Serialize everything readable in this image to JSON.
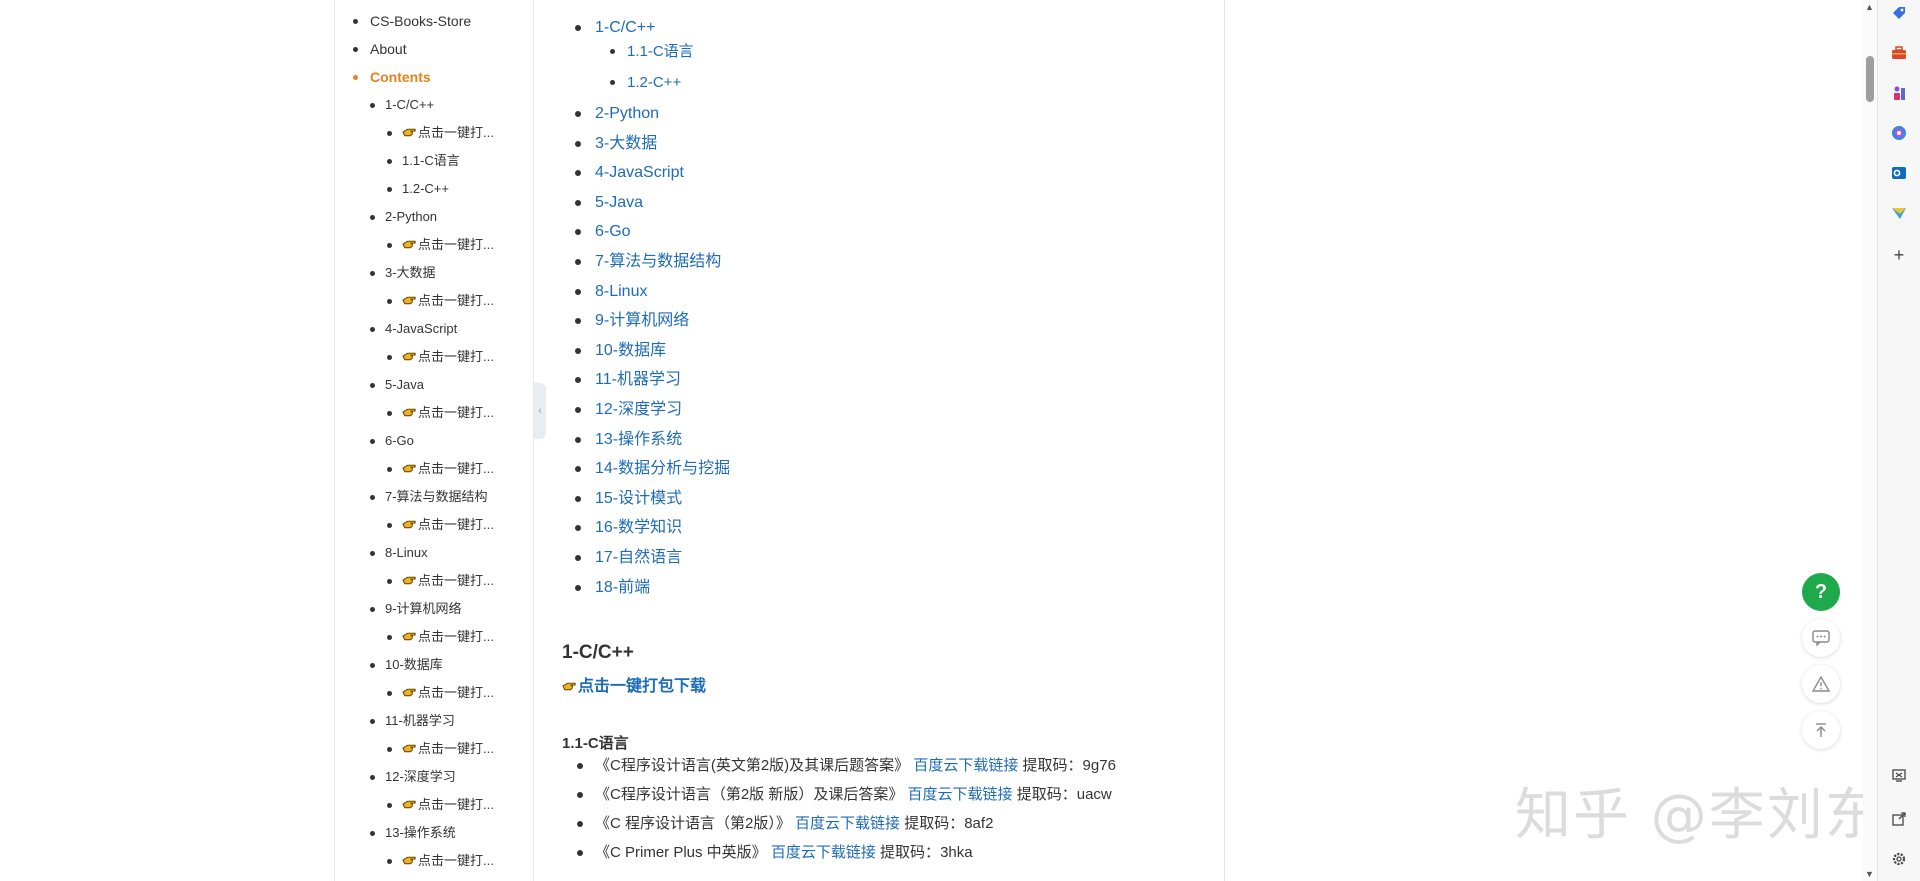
{
  "sidebar": {
    "items": [
      {
        "label": "CS-Books-Store",
        "level": 1
      },
      {
        "label": "About",
        "level": 1
      },
      {
        "label": "Contents",
        "level": 1,
        "active": true
      },
      {
        "label": "1-C/C++",
        "level": 2
      },
      {
        "label": "点击一键打...",
        "level": 3,
        "icon": "hand-pointing-icon"
      },
      {
        "label": "1.1-C语言",
        "level": 3
      },
      {
        "label": "1.2-C++",
        "level": 3
      },
      {
        "label": "2-Python",
        "level": 2
      },
      {
        "label": "点击一键打...",
        "level": 3,
        "icon": "hand-pointing-icon"
      },
      {
        "label": "3-大数据",
        "level": 2
      },
      {
        "label": "点击一键打...",
        "level": 3,
        "icon": "hand-pointing-icon"
      },
      {
        "label": "4-JavaScript",
        "level": 2
      },
      {
        "label": "点击一键打...",
        "level": 3,
        "icon": "hand-pointing-icon"
      },
      {
        "label": "5-Java",
        "level": 2
      },
      {
        "label": "点击一键打...",
        "level": 3,
        "icon": "hand-pointing-icon"
      },
      {
        "label": "6-Go",
        "level": 2
      },
      {
        "label": "点击一键打...",
        "level": 3,
        "icon": "hand-pointing-icon"
      },
      {
        "label": "7-算法与数据结构",
        "level": 2
      },
      {
        "label": "点击一键打...",
        "level": 3,
        "icon": "hand-pointing-icon"
      },
      {
        "label": "8-Linux",
        "level": 2
      },
      {
        "label": "点击一键打...",
        "level": 3,
        "icon": "hand-pointing-icon"
      },
      {
        "label": "9-计算机网络",
        "level": 2
      },
      {
        "label": "点击一键打...",
        "level": 3,
        "icon": "hand-pointing-icon"
      },
      {
        "label": "10-数据库",
        "level": 2
      },
      {
        "label": "点击一键打...",
        "level": 3,
        "icon": "hand-pointing-icon"
      },
      {
        "label": "11-机器学习",
        "level": 2
      },
      {
        "label": "点击一键打...",
        "level": 3,
        "icon": "hand-pointing-icon"
      },
      {
        "label": "12-深度学习",
        "level": 2
      },
      {
        "label": "点击一键打...",
        "level": 3,
        "icon": "hand-pointing-icon"
      },
      {
        "label": "13-操作系统",
        "level": 2
      },
      {
        "label": "点击一键打...",
        "level": 3,
        "icon": "hand-pointing-icon"
      }
    ]
  },
  "content": {
    "toc": [
      {
        "label": "1-C/C++",
        "sub": false
      },
      {
        "label": "1.1-C语言",
        "sub": true
      },
      {
        "label": "1.2-C++",
        "sub": true
      },
      {
        "label": "2-Python",
        "sub": false
      },
      {
        "label": "3-大数据",
        "sub": false
      },
      {
        "label": "4-JavaScript",
        "sub": false
      },
      {
        "label": "5-Java",
        "sub": false
      },
      {
        "label": "6-Go",
        "sub": false
      },
      {
        "label": "7-算法与数据结构",
        "sub": false
      },
      {
        "label": "8-Linux",
        "sub": false
      },
      {
        "label": "9-计算机网络",
        "sub": false
      },
      {
        "label": "10-数据库",
        "sub": false
      },
      {
        "label": "11-机器学习",
        "sub": false
      },
      {
        "label": "12-深度学习",
        "sub": false
      },
      {
        "label": "13-操作系统",
        "sub": false
      },
      {
        "label": "14-数据分析与挖掘",
        "sub": false
      },
      {
        "label": "15-设计模式",
        "sub": false
      },
      {
        "label": "16-数学知识",
        "sub": false
      },
      {
        "label": "17-自然语言",
        "sub": false
      },
      {
        "label": "18-前端",
        "sub": false
      }
    ],
    "section_heading": "1-C/C++",
    "pack_link": "点击一键打包下载",
    "subsection_heading": "1.1-C语言",
    "books": [
      {
        "title": "《C程序设计语言(英文第2版)及其课后题答案》",
        "link": "百度云下载链接",
        "code_label": "提取码：",
        "code": "9g76"
      },
      {
        "title": "《C程序设计语言（第2版 新版）及课后答案》",
        "link": "百度云下载链接",
        "code_label": "提取码：",
        "code": "uacw"
      },
      {
        "title": "《C 程序设计语言（第2版）》",
        "link": "百度云下载链接",
        "code_label": "提取码：",
        "code": "8af2"
      },
      {
        "title": "《C Primer Plus 中英版》",
        "link": "百度云下载链接",
        "code_label": "提取码：",
        "code": "3hka"
      }
    ]
  },
  "watermark": "知乎 @李刘东",
  "fabs": {
    "help": "?"
  },
  "colors": {
    "link": "#1e6bb8",
    "active": "#e6821e",
    "help": "#1ea94a"
  }
}
